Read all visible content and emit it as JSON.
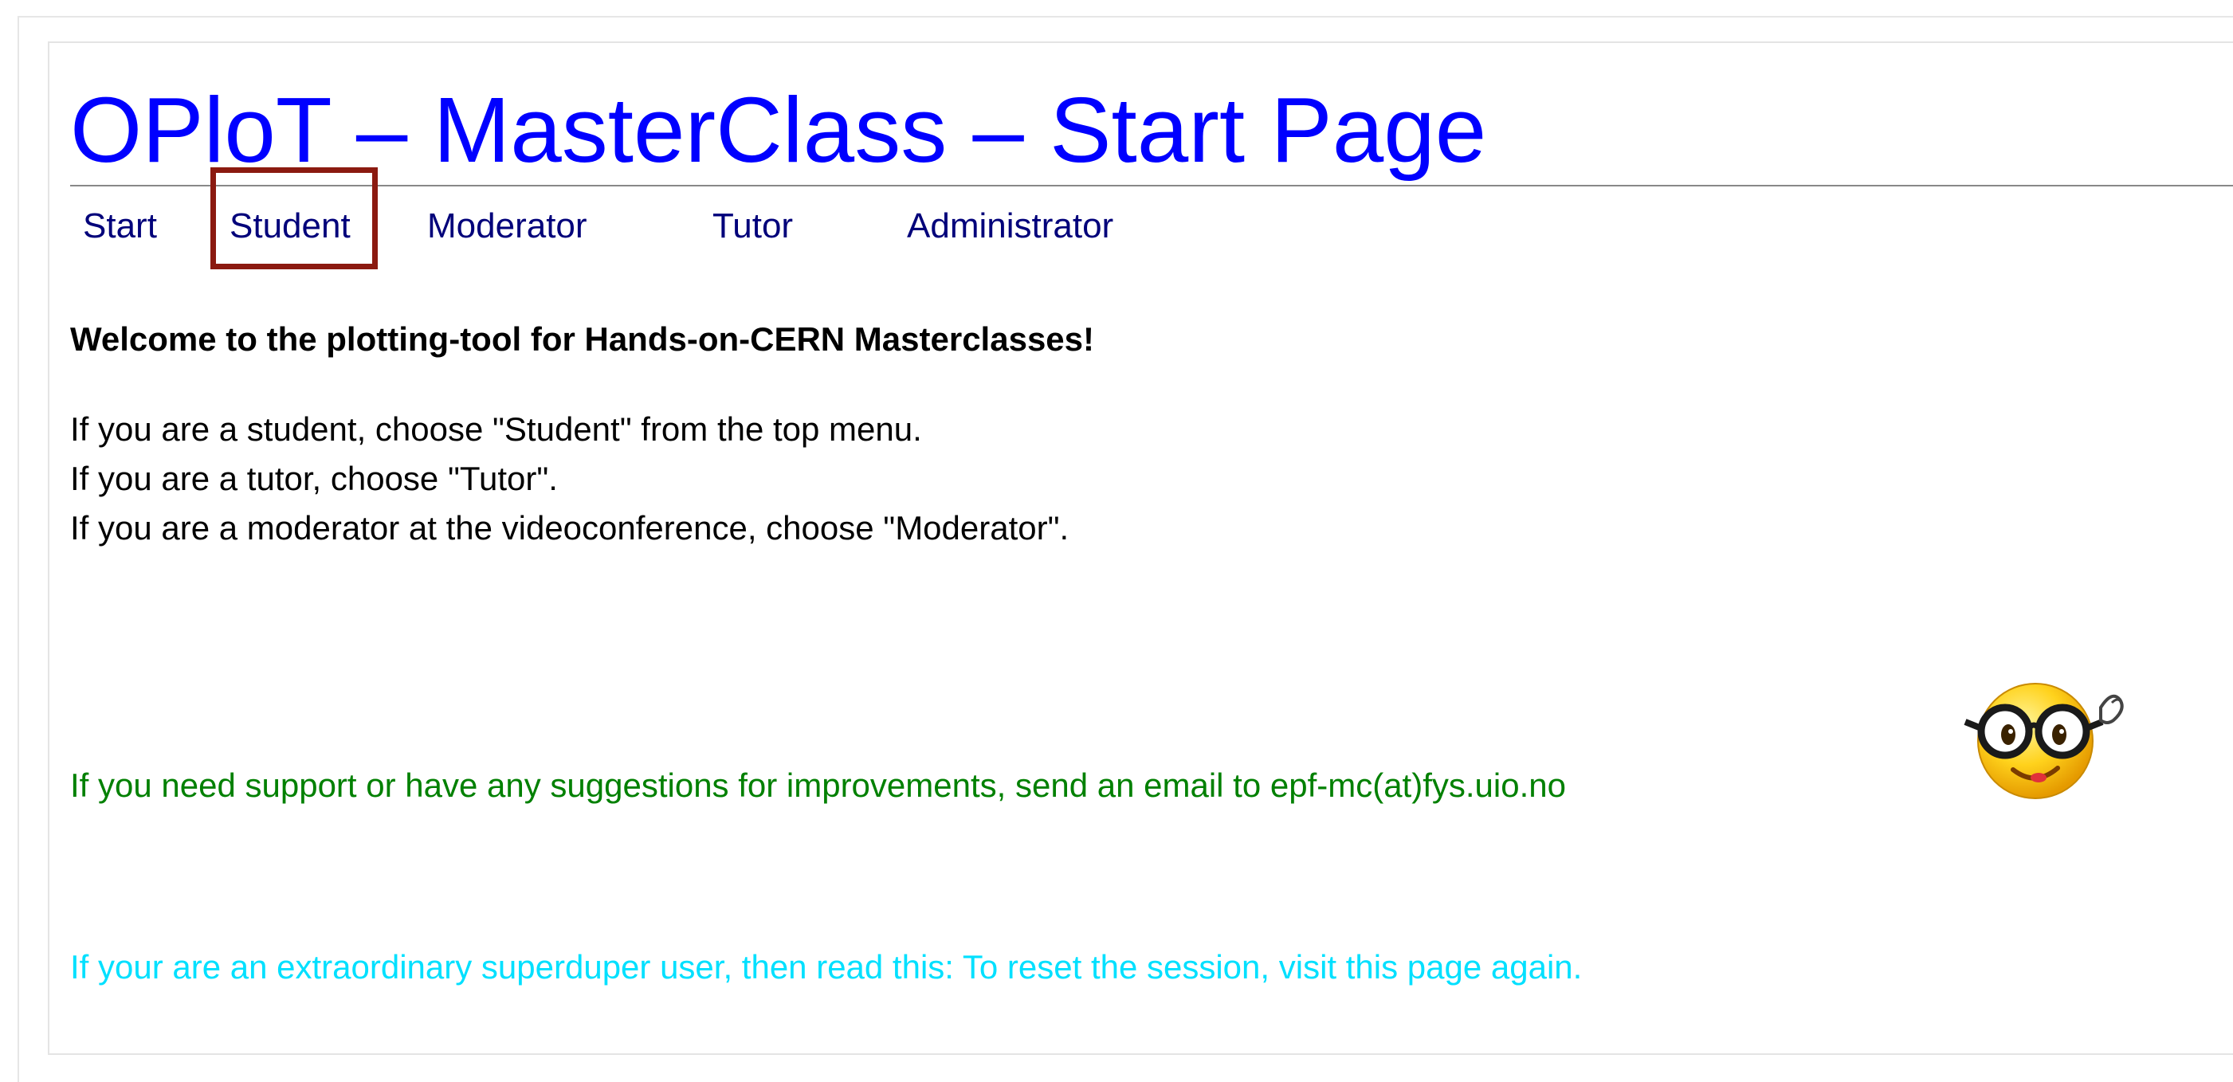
{
  "page": {
    "title": "OPloT – MasterClass – Start Page"
  },
  "nav": {
    "items": [
      {
        "label": "Start"
      },
      {
        "label": "Student"
      },
      {
        "label": "Moderator"
      },
      {
        "label": "Tutor"
      },
      {
        "label": "Administrator"
      }
    ],
    "highlighted": "Student"
  },
  "main": {
    "welcome": "Welcome to the plotting-tool for Hands-on-CERN Masterclasses!",
    "instructions": [
      "If you are a student, choose \"Student\" from the top menu.",
      "If you are a tutor, choose \"Tutor\".",
      "If you are a moderator at the videoconference, choose \"Moderator\"."
    ],
    "support": "If you need support or have any suggestions for improvements, send an email to epf-mc(at)fys.uio.no",
    "reset_note": "If your are an extraordinary superduper user, then read this: To reset the session, visit this page again."
  },
  "icons": {
    "smiley": "nerd-smiley-with-glasses-icon"
  },
  "colors": {
    "title": "#0000ff",
    "nav": "#00007a",
    "support": "#008000",
    "reset_note": "#00e0ff",
    "highlight": "#8b1a10"
  }
}
